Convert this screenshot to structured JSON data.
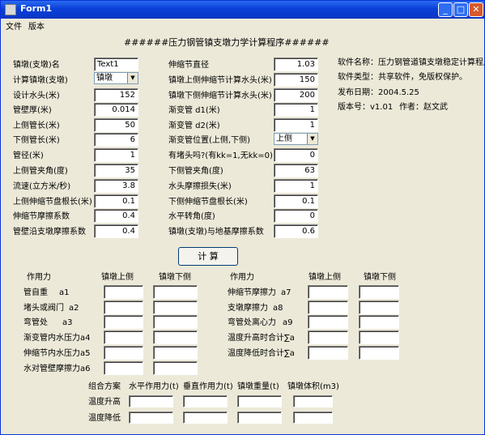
{
  "window": {
    "title": "Form1",
    "minimize": "_",
    "maximize": "□",
    "close": "✕"
  },
  "menu": {
    "file": "文件",
    "version": "版本"
  },
  "form": {
    "heading": "######压力钢管镇支墩力学计算程序######",
    "left_fields": [
      {
        "label": "镇墩(支墩)名",
        "value": "Text1"
      },
      {
        "label": "计算镇墩(支墩)",
        "value": "镇墩"
      },
      {
        "label": "设计水头(米)",
        "value": "152"
      },
      {
        "label": "管壁厚(米)",
        "value": "0.014"
      },
      {
        "label": "上侧管长(米)",
        "value": "50"
      },
      {
        "label": "下侧管长(米)",
        "value": "6"
      },
      {
        "label": "管径(米)",
        "value": "1"
      },
      {
        "label": "上侧管夹角(度)",
        "value": "35"
      },
      {
        "label": "流速(立方米/秒)",
        "value": "3.8"
      },
      {
        "label": "上侧伸缩节盘根长(米)",
        "value": "0.1"
      },
      {
        "label": "伸缩节摩擦系数",
        "value": "0.4"
      },
      {
        "label": "管壁沿支墩摩擦系数",
        "value": "0.4"
      }
    ],
    "right_fields": [
      {
        "label": "伸缩节直径",
        "value": "1.03"
      },
      {
        "label": "镇墩上侧伸缩节计算水头(米)",
        "value": "150"
      },
      {
        "label": "镇墩下侧伸缩节计算水头(米)",
        "value": "200"
      },
      {
        "label": "渐变管 d1(米)",
        "value": "1"
      },
      {
        "label": "渐变管 d2(米)",
        "value": "1"
      },
      {
        "label": "渐变管位置(上侧,下侧)",
        "value": "上侧"
      },
      {
        "label": "有堵头吗?(有kk=1,无kk=0)",
        "value": "0"
      },
      {
        "label": "下侧管夹角(度)",
        "value": "63"
      },
      {
        "label": "水头摩擦损失(米)",
        "value": "1"
      },
      {
        "label": "下侧伸缩节盘根长(米)",
        "value": "0.1"
      },
      {
        "label": "水平转角(度)",
        "value": "0"
      },
      {
        "label": "镇墩(支墩)与地基摩擦系数",
        "value": "0.6"
      }
    ],
    "info": [
      "软件名称：压力钢管道镇支墩稳定计算程序",
      "软件类型：共享软件，免版权保护。",
      "发布日期：2004.5.25",
      "版本号：v1.01",
      "作者：赵文武"
    ],
    "calc_button": "计 算"
  },
  "results": {
    "left_headers": [
      "作用力",
      "镇墩上侧",
      "镇墩下侧"
    ],
    "left_rows": [
      {
        "name": "管自重",
        "code": "a1"
      },
      {
        "name": "堵头或阀门",
        "code": "a2"
      },
      {
        "name": "弯管处",
        "code": "a3"
      },
      {
        "name": "渐变管内水压力a4",
        "code": ""
      },
      {
        "name": "伸缩节内水压力a5",
        "code": ""
      },
      {
        "name": "水对管壁摩擦力a6",
        "code": ""
      }
    ],
    "right_headers": [
      "作用力",
      "镇墩上侧",
      "镇墩下侧"
    ],
    "right_rows": [
      {
        "name": "伸缩节摩擦力",
        "code": "a7"
      },
      {
        "name": "支墩摩擦力",
        "code": "a8"
      },
      {
        "name": "弯管处离心力",
        "code": "a9"
      },
      {
        "name": "温度升高时合计∑a",
        "code": ""
      },
      {
        "name": "温度降低时合计∑a",
        "code": ""
      }
    ],
    "combo_headers": [
      "组合方案",
      "水平作用力(t)",
      "垂直作用力(t)",
      "镇墩重量(t)",
      "镇墩体积(m3)"
    ],
    "combo_rows": [
      "温度升高",
      "温度降低"
    ]
  }
}
